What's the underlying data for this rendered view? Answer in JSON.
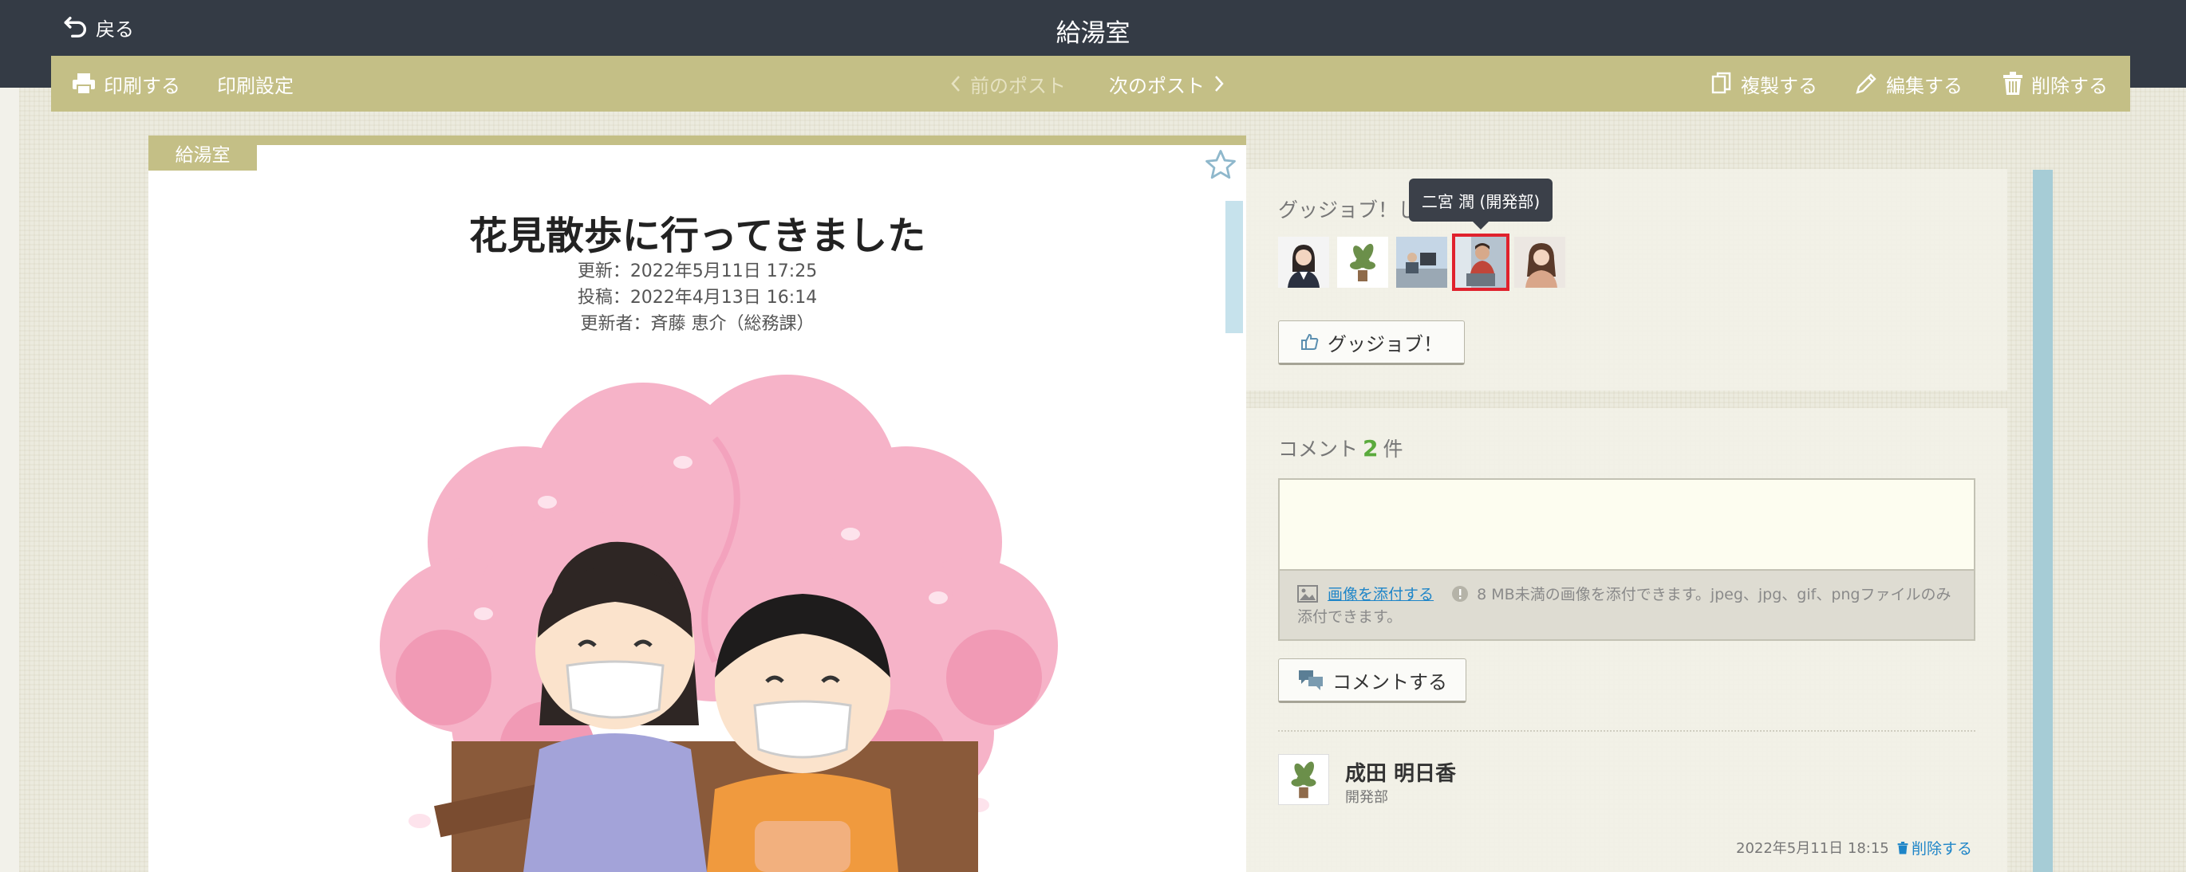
{
  "header": {
    "back_label": "戻る",
    "title": "給湯室"
  },
  "toolbar": {
    "print_label": "印刷する",
    "print_settings_label": "印刷設定",
    "prev_post_label": "前のポスト",
    "next_post_label": "次のポスト",
    "duplicate_label": "複製する",
    "edit_label": "編集する",
    "delete_label": "削除する"
  },
  "post": {
    "category": "給湯室",
    "title": "花見散歩に行ってきました",
    "updated": "更新：2022年5月11日 17:25",
    "posted": "投稿：2022年4月13日 16:14",
    "updated_by": "更新者：斉藤 恵介（総務課）"
  },
  "goodjob": {
    "title_visible": "グッジョブ！し",
    "tooltip": "二宮 潤 (開発部)",
    "button_label": "グッジョブ！",
    "avatars": [
      "woman-suit-avatar",
      "plant-avatar",
      "office-desk-avatar",
      "man-laptop-avatar",
      "woman-avatar"
    ]
  },
  "comments": {
    "title": "コメント",
    "count": "2",
    "count_unit": "件",
    "attach_link": "画像を添付する",
    "attach_note": "8 MB未満の画像を添付できます。jpeg、jpg、gif、pngファイルのみ添付できます。",
    "submit_label": "コメントする",
    "items": [
      {
        "author": "成田 明日香",
        "department": "開発部",
        "date": "2022年5月11日 18:15",
        "delete_label": "削除する"
      }
    ]
  },
  "colors": {
    "topbar": "#343b45",
    "toolbar": "#c4bf86",
    "count_accent": "#5aaa3c",
    "link": "#1e85c8",
    "selected_outline": "#e0222d"
  }
}
